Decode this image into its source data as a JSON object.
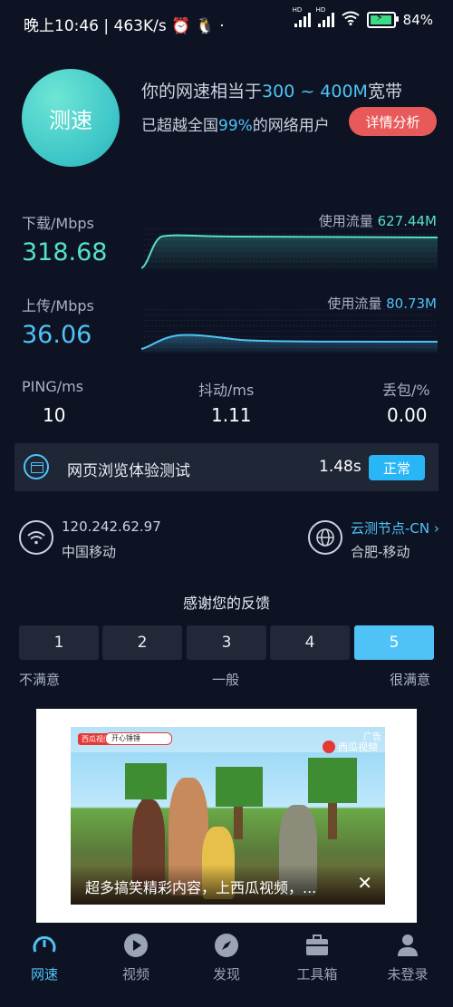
{
  "status": {
    "time": "晚上10:46",
    "speed": "463K/s",
    "battery": "84%"
  },
  "header": {
    "circle_label": "测速",
    "equiv_prefix": "你的网速相当于",
    "equiv_range": "300 ~ 400M",
    "equiv_suffix": "宽带",
    "beat_prefix": "已超越全国",
    "beat_pct": "99%",
    "beat_suffix": "的网络用户",
    "detail_btn": "详情分析"
  },
  "download": {
    "label": "下载/Mbps",
    "value": "318.68",
    "usage_label": "使用流量",
    "usage_value": "627.44M"
  },
  "upload": {
    "label": "上传/Mbps",
    "value": "36.06",
    "usage_label": "使用流量",
    "usage_value": "80.73M"
  },
  "stats": {
    "ping_label": "PING/ms",
    "ping_value": "10",
    "jitter_label": "抖动/ms",
    "jitter_value": "1.11",
    "loss_label": "丢包/%",
    "loss_value": "0.00"
  },
  "web_test": {
    "title": "网页浏览体验测试",
    "time": "1.48s",
    "badge": "正常"
  },
  "network": {
    "ip": "120.242.62.97",
    "isp": "中国移动",
    "node_title": "云测节点-CN",
    "node_chevron": "›",
    "node_sub": "合肥-移动"
  },
  "feedback": {
    "title": "感谢您的反馈",
    "options": [
      "1",
      "2",
      "3",
      "4",
      "5"
    ],
    "selected": "5",
    "caption_low": "不满意",
    "caption_mid": "一般",
    "caption_high": "很满意"
  },
  "ad": {
    "brand": "西瓜视频",
    "search": "开心锤锤",
    "tag": "广告",
    "logo": "西瓜视频",
    "caption": "超多搞笑精彩内容，上西瓜视频，...",
    "close": "✕"
  },
  "nav": [
    {
      "label": "网速",
      "icon": "speedometer-icon",
      "active": true
    },
    {
      "label": "视频",
      "icon": "play-icon",
      "active": false
    },
    {
      "label": "发现",
      "icon": "compass-icon",
      "active": false
    },
    {
      "label": "工具箱",
      "icon": "toolbox-icon",
      "active": false
    },
    {
      "label": "未登录",
      "icon": "user-icon",
      "active": false
    }
  ],
  "colors": {
    "accent": "#4fc3f7",
    "download": "#56e0c8",
    "danger": "#e85a5a"
  }
}
